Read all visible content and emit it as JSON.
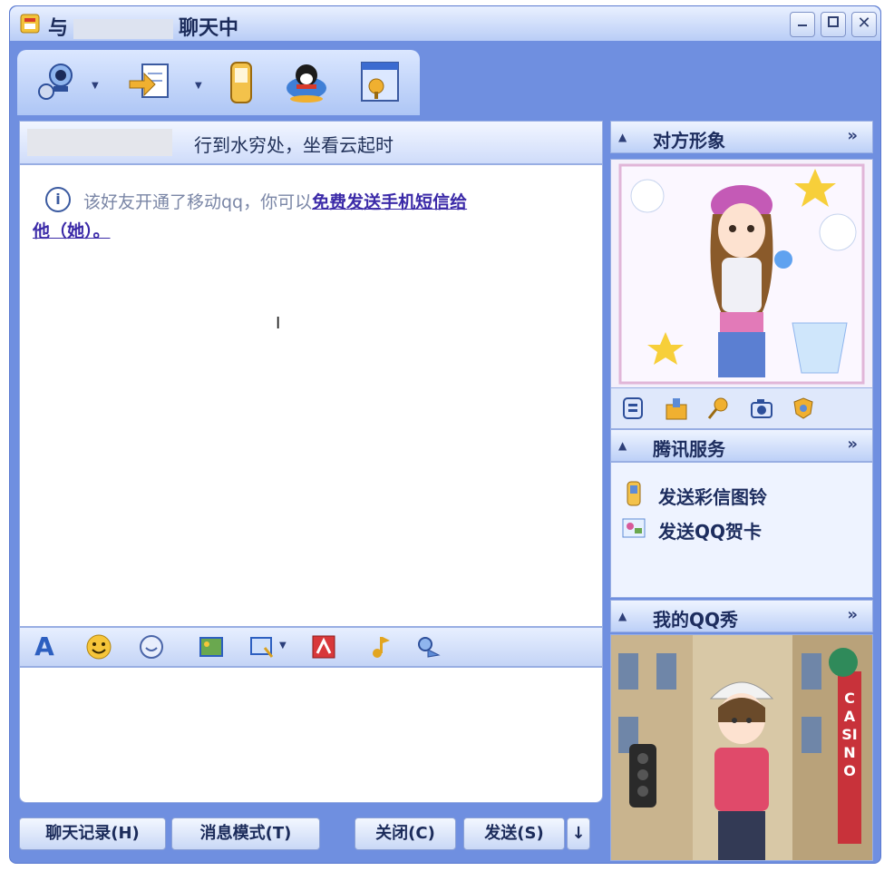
{
  "window": {
    "title_prefix": "与",
    "title_suffix": "聊天中",
    "controls": [
      "minimize-icon",
      "maximize-icon",
      "close-icon"
    ],
    "close_glyph": "✕"
  },
  "toolbar": {
    "icons": [
      "video-call-icon",
      "file-transfer-icon",
      "mobile-phone-icon",
      "qq-penguin-icon",
      "info-card-icon"
    ],
    "dropdown_glyph": "▼"
  },
  "contact": {
    "signature": "行到水穷处，坐看云起时"
  },
  "chat": {
    "notice_text": "该好友开通了移动qq，你可以",
    "notice_link": "免费发送手机短信给",
    "notice_link_cont": "他（她）。",
    "info_glyph": "i",
    "caret": "I"
  },
  "format_toolbar": {
    "font_glyph": "A",
    "icons": [
      "font-icon",
      "emoji-icon",
      "magic-emoticon-icon",
      "image-icon",
      "screenshot-icon",
      "scene-icon",
      "music-icon",
      "handwriting-icon"
    ]
  },
  "buttons": {
    "history": "聊天记录(H)",
    "message_mode": "消息模式(T)",
    "close": "关闭(C)",
    "send": "发送(S)",
    "send_options": "↓"
  },
  "side": {
    "panel1_title": "对方形象",
    "panel2_title": "腾讯服务",
    "panel3_title": "我的QQ秀",
    "collapse_glyph": "▲",
    "more_glyph": "»",
    "services": [
      {
        "label": "发送彩信图铃",
        "icon": "phone-mms-icon"
      },
      {
        "label": "发送QQ贺卡",
        "icon": "greeting-card-icon"
      }
    ],
    "avatar_tools": [
      "dress-up-icon",
      "shop-icon",
      "pin-icon",
      "camera-icon",
      "shield-icon"
    ],
    "casino_sign": "CASINO"
  },
  "colors": {
    "frame": "#6f8fe0",
    "header": "#bdd0f7",
    "link": "#3b2aa8"
  }
}
